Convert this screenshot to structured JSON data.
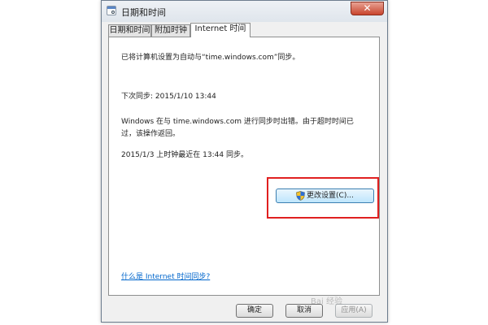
{
  "window": {
    "title": "日期和时间",
    "close_glyph": "✕"
  },
  "tabs": [
    {
      "label": "日期和时间",
      "active": false
    },
    {
      "label": "附加时钟",
      "active": false
    },
    {
      "label": "Internet 时间",
      "active": true
    }
  ],
  "panel": {
    "sync_config": "已将计算机设置为自动与“time.windows.com”同步。",
    "next_sync": "下次同步: 2015/1/10 13:44",
    "error_message": "Windows 在与 time.windows.com 进行同步时出错。由于超时时间已过，该操作返回。",
    "last_sync": "2015/1/3 上时钟最近在 13:44 同步。",
    "change_settings_label": "更改设置(C)...",
    "help_link": "什么是 Internet 时间同步?"
  },
  "footer": {
    "ok_label": "确定",
    "cancel_label": "取消",
    "apply_label": "应用(A)"
  },
  "watermark": "Bai 经验",
  "colors": {
    "highlight": "#e02020",
    "link": "#0066cc",
    "close": "#c9452d"
  },
  "icons": [
    "clock-icon",
    "close-icon",
    "uac-shield-icon"
  ]
}
